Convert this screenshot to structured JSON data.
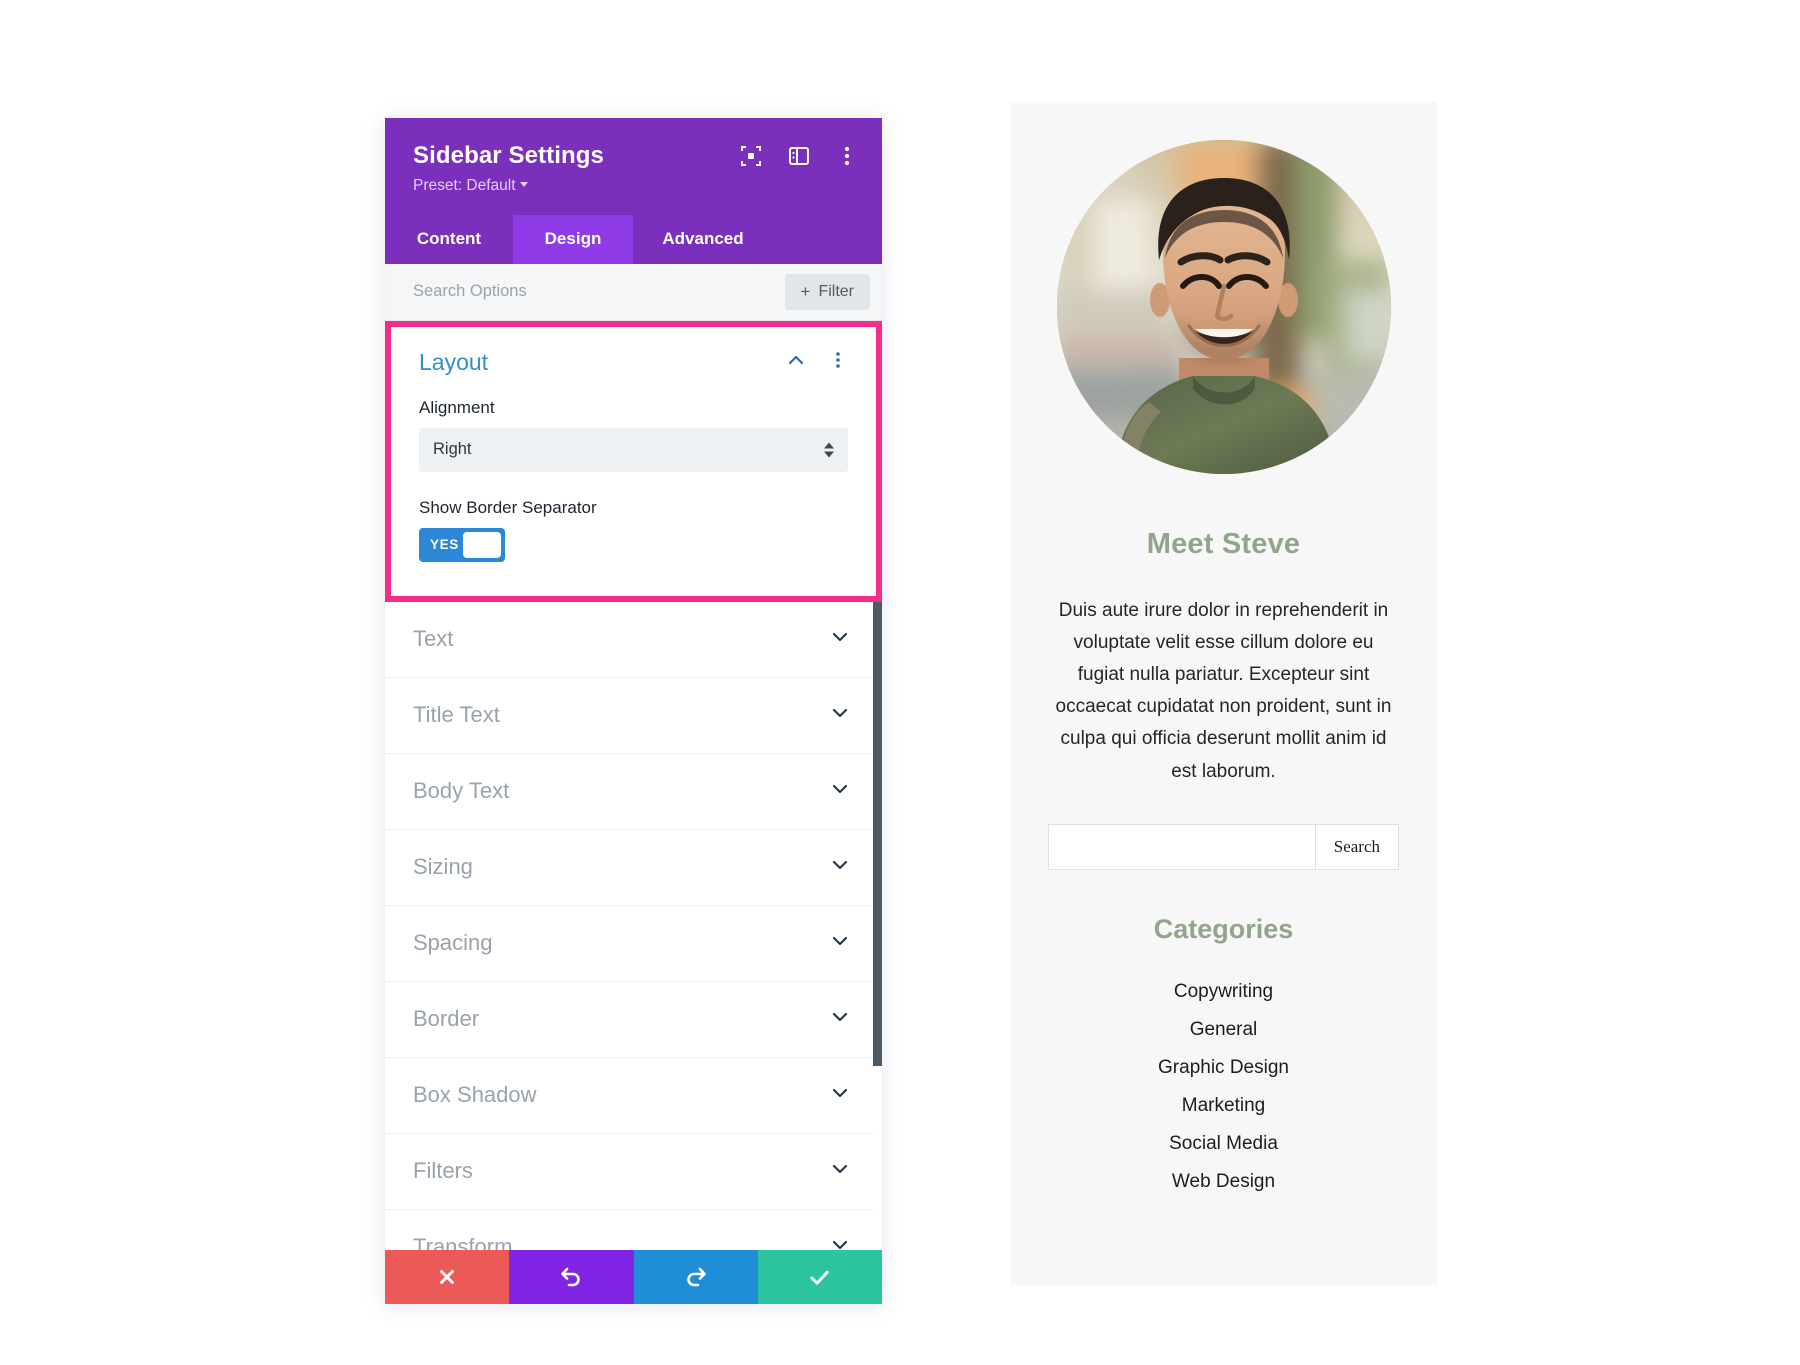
{
  "settings_panel": {
    "title": "Sidebar Settings",
    "preset": "Preset: Default",
    "header_icons": [
      {
        "name": "focus-target-icon"
      },
      {
        "name": "panel-layout-icon"
      },
      {
        "name": "more-options-icon"
      }
    ],
    "tabs": [
      {
        "label": "Content",
        "active": false
      },
      {
        "label": "Design",
        "active": true
      },
      {
        "label": "Advanced",
        "active": false
      }
    ],
    "search": {
      "placeholder": "Search Options",
      "value": ""
    },
    "filter_button": {
      "plus": "+",
      "label": "Filter"
    },
    "open_section": {
      "title": "Layout",
      "alignment": {
        "label": "Alignment",
        "value": "Right"
      },
      "border_separator": {
        "label": "Show Border Separator",
        "toggle_value": "YES"
      }
    },
    "collapsed_sections": [
      {
        "label": "Text"
      },
      {
        "label": "Title Text"
      },
      {
        "label": "Body Text"
      },
      {
        "label": "Sizing"
      },
      {
        "label": "Spacing"
      },
      {
        "label": "Border"
      },
      {
        "label": "Box Shadow"
      },
      {
        "label": "Filters"
      },
      {
        "label": "Transform"
      }
    ],
    "footer_buttons": [
      {
        "name": "close-button",
        "glyph": "✕"
      },
      {
        "name": "undo-button",
        "glyph": "↺"
      },
      {
        "name": "redo-button",
        "glyph": "↻"
      },
      {
        "name": "save-button",
        "glyph": "✓"
      }
    ],
    "colors": {
      "header_purple": "#7a2fbd",
      "active_tab_purple": "#8f3ce8",
      "highlight_pink": "#f42d8a",
      "section_title_blue": "#2f8fd0",
      "toggle_blue": "#2c87d6",
      "close_red": "#ec5a57",
      "undo_purple": "#8224e3",
      "redo_blue": "#1f8ed6",
      "save_green": "#2dc4a0"
    }
  },
  "preview": {
    "avatar_alt": "Portrait of a smiling man in an olive green shirt",
    "heading": "Meet Steve",
    "body": "Duis aute irure dolor in reprehenderit in voluptate velit esse cillum dolore eu fugiat nulla pariatur. Excepteur sint occaecat cupidatat non proident, sunt in culpa qui officia deserunt mollit anim id est laborum.",
    "search": {
      "value": "",
      "button_label": "Search"
    },
    "categories_heading": "Categories",
    "categories": [
      "Copywriting",
      "General",
      "Graphic Design",
      "Marketing",
      "Social Media",
      "Web Design"
    ],
    "colors": {
      "heading_sage": "#93a48d",
      "background": "#f7f7f7"
    }
  }
}
